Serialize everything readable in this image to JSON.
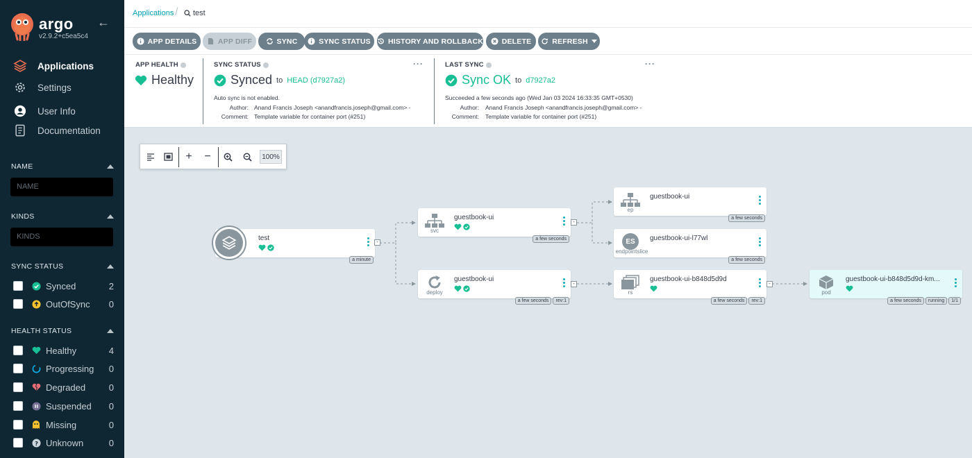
{
  "brand": {
    "name": "argo",
    "version": "v2.9.2+c5ea5c4"
  },
  "nav": [
    {
      "label": "Applications",
      "icon": "layers-icon",
      "active": true
    },
    {
      "label": "Settings",
      "icon": "gear-icon",
      "active": false
    },
    {
      "label": "User Info",
      "icon": "user-icon",
      "active": false
    },
    {
      "label": "Documentation",
      "icon": "docs-icon",
      "active": false
    }
  ],
  "filters": {
    "name": {
      "header": "NAME",
      "placeholder": "NAME"
    },
    "kinds": {
      "header": "KINDS",
      "placeholder": "KINDS"
    },
    "sync": {
      "header": "SYNC STATUS",
      "items": [
        {
          "label": "Synced",
          "count": "2",
          "icon": "synced-icon",
          "color": "#18be94"
        },
        {
          "label": "OutOfSync",
          "count": "0",
          "icon": "out-of-sync-icon",
          "color": "#f4c030"
        }
      ]
    },
    "health": {
      "header": "HEALTH STATUS",
      "items": [
        {
          "label": "Healthy",
          "count": "4",
          "icon": "heart-icon",
          "color": "#18be94"
        },
        {
          "label": "Progressing",
          "count": "0",
          "icon": "progressing-icon",
          "color": "#0dadea"
        },
        {
          "label": "Degraded",
          "count": "0",
          "icon": "broken-heart-icon",
          "color": "#e96d76"
        },
        {
          "label": "Suspended",
          "count": "0",
          "icon": "pause-icon",
          "color": "#766f94"
        },
        {
          "label": "Missing",
          "count": "0",
          "icon": "ghost-icon",
          "color": "#f4c030"
        },
        {
          "label": "Unknown",
          "count": "0",
          "icon": "question-icon",
          "color": "#ccd6dd"
        }
      ]
    }
  },
  "breadcrumb": {
    "root": "Applications",
    "current": "test"
  },
  "toolbar": {
    "app_details": "APP DETAILS",
    "app_diff": "APP DIFF",
    "sync": "SYNC",
    "sync_status": "SYNC STATUS",
    "history": "HISTORY AND ROLLBACK",
    "delete": "DELETE",
    "refresh": "REFRESH"
  },
  "status": {
    "app_health": {
      "header": "APP HEALTH",
      "value": "Healthy"
    },
    "sync_status": {
      "header": "SYNC STATUS",
      "value": "Synced",
      "to": "to",
      "revision": "HEAD (d7927a2)",
      "note": "Auto sync is not enabled.",
      "author_label": "Author:",
      "author": "Anand Francis Joseph <anandfrancis.joseph@gmail.com> -",
      "comment_label": "Comment:",
      "comment": "Template variable for container port (#251)"
    },
    "last_sync": {
      "header": "LAST SYNC",
      "value": "Sync OK",
      "to": "to",
      "revision": "d7927a2",
      "note": "Succeeded a few seconds ago (Wed Jan 03 2024 16:33:35 GMT+0530)",
      "author_label": "Author:",
      "author": "Anand Francis Joseph <anandfrancis.joseph@gmail.com> -",
      "comment_label": "Comment:",
      "comment": "Template variable for container port (#251)"
    },
    "more": "···"
  },
  "zoom": {
    "level": "100%"
  },
  "nodes": {
    "app": {
      "title": "test",
      "tags": [
        "a minute"
      ]
    },
    "svc": {
      "title": "guestbook-ui",
      "kind": "svc",
      "tags": [
        "a few seconds"
      ]
    },
    "deploy": {
      "title": "guestbook-ui",
      "kind": "deploy",
      "tags": [
        "a few seconds",
        "rev:1"
      ]
    },
    "ep": {
      "title": "guestbook-ui",
      "kind": "ep",
      "tags": [
        "a few seconds"
      ]
    },
    "eps": {
      "title": "guestbook-ui-l77wl",
      "kind": "endpointslice",
      "badge": "ES",
      "tags": [
        "a few seconds"
      ]
    },
    "rs": {
      "title": "guestbook-ui-b848d5d9d",
      "kind": "rs",
      "tags": [
        "a few seconds",
        "rev:1"
      ]
    },
    "pod": {
      "title": "guestbook-ui-b848d5d9d-km...",
      "kind": "pod",
      "tags": [
        "a few seconds",
        "running",
        "1/1"
      ]
    }
  },
  "colors": {
    "sidebar": "#0f2733",
    "accent": "#18be94",
    "button": "#6d7f8b",
    "canvas": "#dee6eb",
    "link": "#00a2b3"
  }
}
